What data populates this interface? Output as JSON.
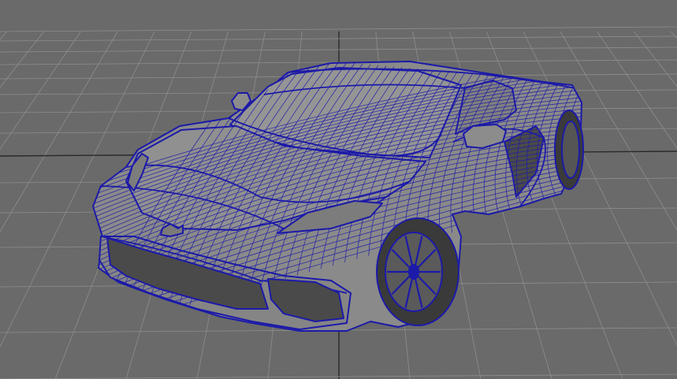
{
  "viewport": {
    "background": "#6a6a6a",
    "grid_color": "#8e8e8e",
    "grid_axis_color": "#2a2a2a",
    "wire_color": "#1c1aa8",
    "surface_fill": "#8a8a8a",
    "surface_dark": "#4a4a4a",
    "tire_fill": "#3a3a3a"
  }
}
